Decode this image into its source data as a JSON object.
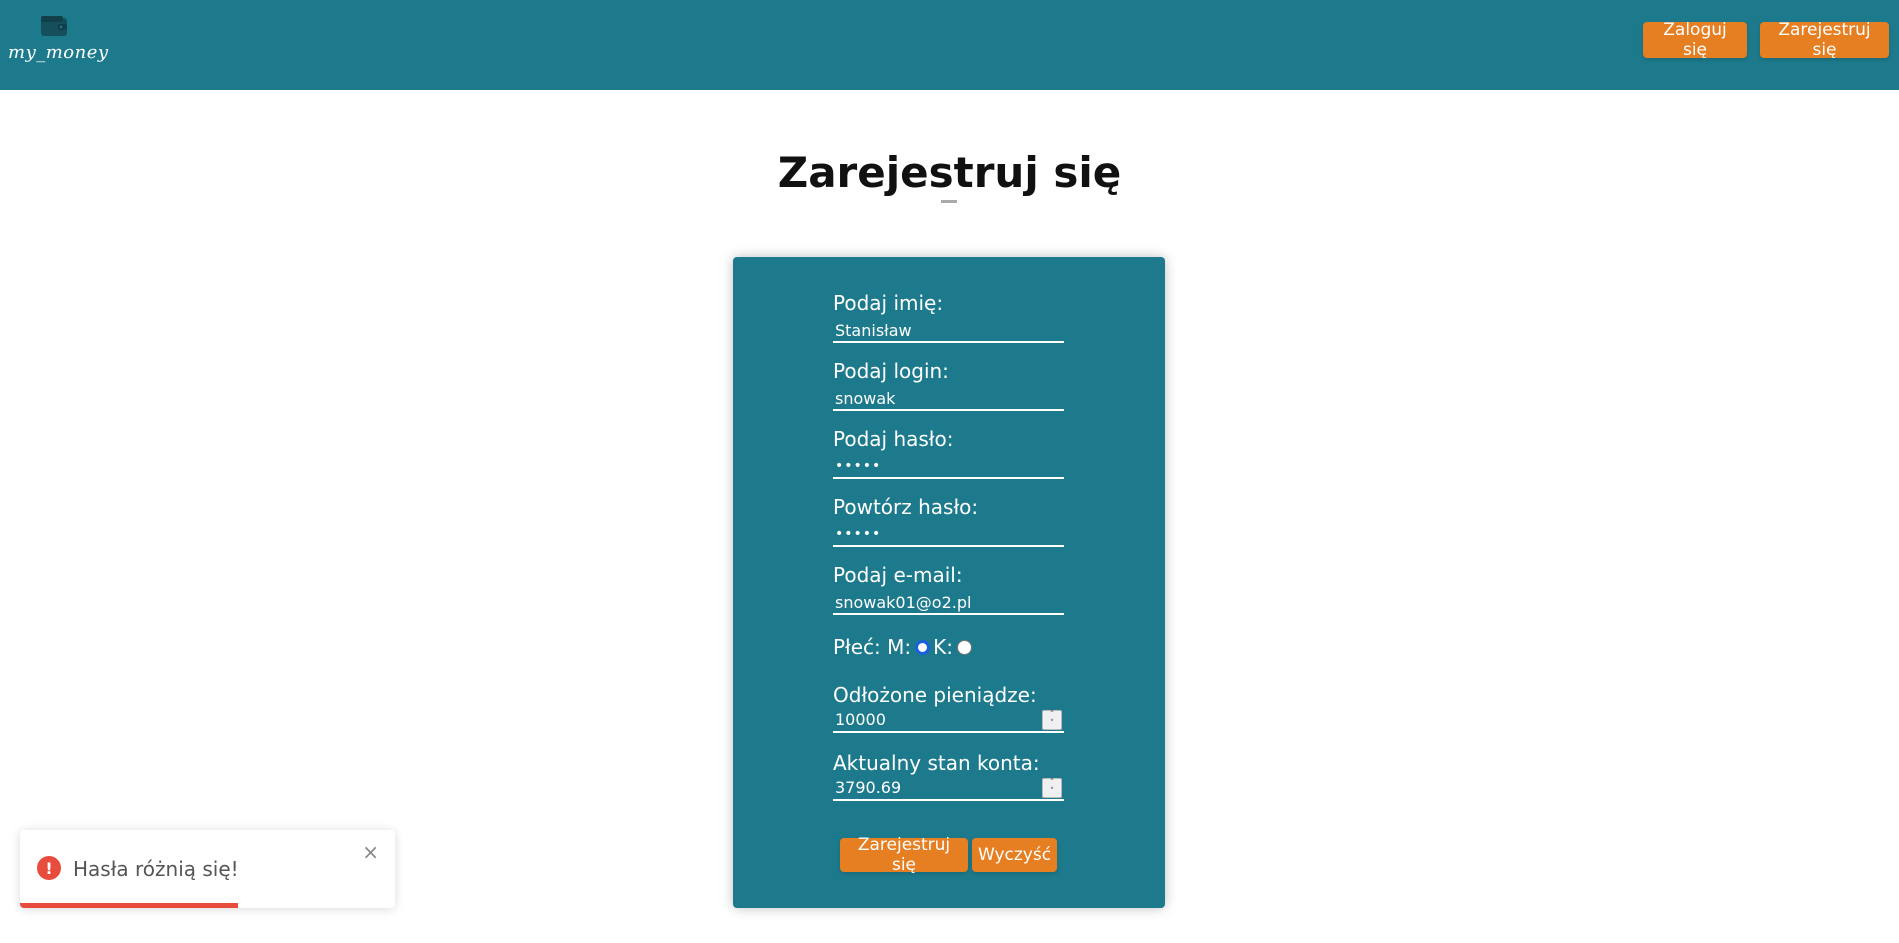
{
  "header": {
    "logo_text": "my_money",
    "login_label": "Zaloguj się",
    "register_label": "Zarejestruj się"
  },
  "page": {
    "title": "Zarejestruj się"
  },
  "form": {
    "name_label": "Podaj imię:",
    "name_value": "Stanisław",
    "login_label": "Podaj login:",
    "login_value": "snowak",
    "password_label": "Podaj hasło:",
    "password_masked": "•••••",
    "repeat_password_label": "Powtórz hasło:",
    "repeat_password_masked": "•••••",
    "email_label": "Podaj e-mail:",
    "email_value": "snowak01@o2.pl",
    "gender_label": "Płeć: M:",
    "gender_k_label": "K:",
    "gender_selected": "M",
    "savings_label": "Odłożone pieniądze:",
    "savings_value": "10000",
    "balance_label": "Aktualny stan konta:",
    "balance_value": "3790.69",
    "submit_label": "Zarejestruj się",
    "clear_label": "Wyczyść"
  },
  "toast": {
    "message": "Hasła różnią się!",
    "icon": "error-icon",
    "close_glyph": "×",
    "progress_fraction": 0.58
  },
  "colors": {
    "primary": "#1d7a8c",
    "accent": "#e67e22",
    "error": "#e74c3c"
  }
}
